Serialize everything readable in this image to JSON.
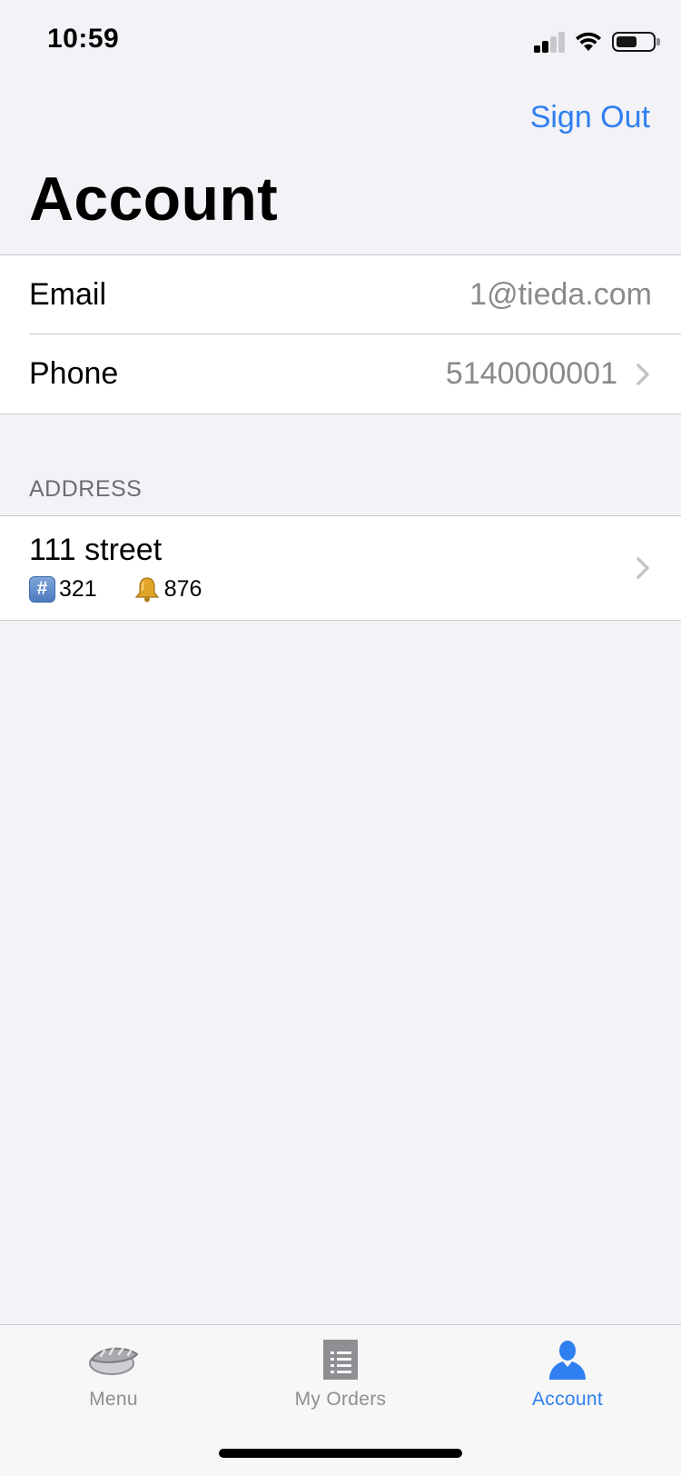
{
  "status_bar": {
    "time": "10:59"
  },
  "nav": {
    "sign_out_label": "Sign Out",
    "title": "Account"
  },
  "account_rows": [
    {
      "label": "Email",
      "value": "1@tieda.com"
    },
    {
      "label": "Phone",
      "value": "5140000001"
    }
  ],
  "address_section": {
    "header": "ADDRESS",
    "street": "111 street",
    "unit": "321",
    "buzzer": "876",
    "unit_icon": "hash-keycap-icon",
    "buzzer_icon": "bell-icon"
  },
  "tab_bar": {
    "tabs": [
      {
        "label": "Menu",
        "icon": "sushi-icon"
      },
      {
        "label": "My Orders",
        "icon": "receipt-list-icon"
      },
      {
        "label": "Account",
        "icon": "person-icon"
      }
    ],
    "selected": "Account"
  },
  "colors": {
    "accent": "#2f7ff0",
    "background": "#f2f2f7",
    "secondary_text": "#8a8a8e"
  }
}
